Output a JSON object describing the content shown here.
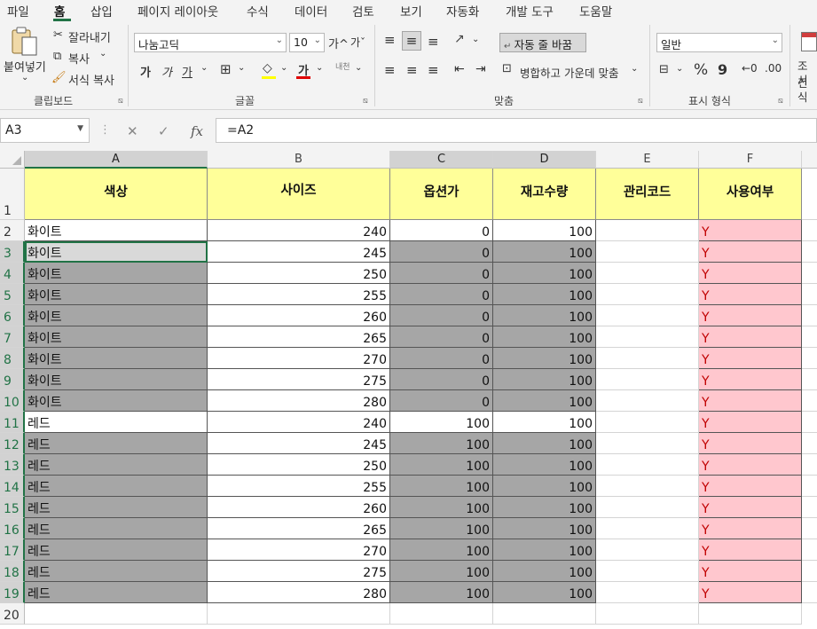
{
  "menu": {
    "tabs": [
      "파일",
      "홈",
      "삽입",
      "페이지 레이아웃",
      "수식",
      "데이터",
      "검토",
      "보기",
      "자동화",
      "개발 도구",
      "도움말"
    ]
  },
  "ribbon": {
    "clipboard": {
      "paste": "붙여넣기",
      "cut": "잘라내기",
      "copy": "복사",
      "format_painter": "서식 복사",
      "label": "클립보드"
    },
    "font": {
      "name": "나눔고딕",
      "size": "10",
      "label": "글꼴",
      "bold": "가",
      "italic": "가",
      "underline": "가",
      "grow": "가^",
      "shrink": "가ˇ",
      "font_color": "가"
    },
    "alignment": {
      "wrap": "자동 줄 바꿈",
      "merge": "병합하고 가운데 맞춤",
      "label": "맞춤"
    },
    "number": {
      "format": "일반",
      "label": "표시 형식",
      "percent": "%",
      "comma": "9"
    },
    "styles": {
      "conditional": "조건",
      "format": "서식"
    }
  },
  "formula_bar": {
    "name_box": "A3",
    "formula": "=A2"
  },
  "columns": [
    "A",
    "B",
    "C",
    "D",
    "E",
    "F"
  ],
  "headers": [
    "색상",
    "사이즈",
    "옵션가",
    "재고수량",
    "관리코드",
    "사용여부"
  ],
  "rows": [
    {
      "row": "2",
      "color": "화이트",
      "size": "240",
      "option": "0",
      "stock": "100",
      "code": "",
      "use": "Y"
    },
    {
      "row": "3",
      "color": "화이트",
      "size": "245",
      "option": "0",
      "stock": "100",
      "code": "",
      "use": "Y"
    },
    {
      "row": "4",
      "color": "화이트",
      "size": "250",
      "option": "0",
      "stock": "100",
      "code": "",
      "use": "Y"
    },
    {
      "row": "5",
      "color": "화이트",
      "size": "255",
      "option": "0",
      "stock": "100",
      "code": "",
      "use": "Y"
    },
    {
      "row": "6",
      "color": "화이트",
      "size": "260",
      "option": "0",
      "stock": "100",
      "code": "",
      "use": "Y"
    },
    {
      "row": "7",
      "color": "화이트",
      "size": "265",
      "option": "0",
      "stock": "100",
      "code": "",
      "use": "Y"
    },
    {
      "row": "8",
      "color": "화이트",
      "size": "270",
      "option": "0",
      "stock": "100",
      "code": "",
      "use": "Y"
    },
    {
      "row": "9",
      "color": "화이트",
      "size": "275",
      "option": "0",
      "stock": "100",
      "code": "",
      "use": "Y"
    },
    {
      "row": "10",
      "color": "화이트",
      "size": "280",
      "option": "0",
      "stock": "100",
      "code": "",
      "use": "Y"
    },
    {
      "row": "11",
      "color": "레드",
      "size": "240",
      "option": "100",
      "stock": "100",
      "code": "",
      "use": "Y"
    },
    {
      "row": "12",
      "color": "레드",
      "size": "245",
      "option": "100",
      "stock": "100",
      "code": "",
      "use": "Y"
    },
    {
      "row": "13",
      "color": "레드",
      "size": "250",
      "option": "100",
      "stock": "100",
      "code": "",
      "use": "Y"
    },
    {
      "row": "14",
      "color": "레드",
      "size": "255",
      "option": "100",
      "stock": "100",
      "code": "",
      "use": "Y"
    },
    {
      "row": "15",
      "color": "레드",
      "size": "260",
      "option": "100",
      "stock": "100",
      "code": "",
      "use": "Y"
    },
    {
      "row": "16",
      "color": "레드",
      "size": "265",
      "option": "100",
      "stock": "100",
      "code": "",
      "use": "Y"
    },
    {
      "row": "17",
      "color": "레드",
      "size": "270",
      "option": "100",
      "stock": "100",
      "code": "",
      "use": "Y"
    },
    {
      "row": "18",
      "color": "레드",
      "size": "275",
      "option": "100",
      "stock": "100",
      "code": "",
      "use": "Y"
    },
    {
      "row": "19",
      "color": "레드",
      "size": "280",
      "option": "100",
      "stock": "100",
      "code": "",
      "use": "Y"
    }
  ],
  "header_row": "1",
  "empty_row": "20",
  "colors": {
    "accent": "#217346",
    "header_fill": "#ffff99",
    "gray_fill": "#a6a6a6",
    "pink_fill": "#ffc7ce",
    "pink_text": "#c00000"
  }
}
